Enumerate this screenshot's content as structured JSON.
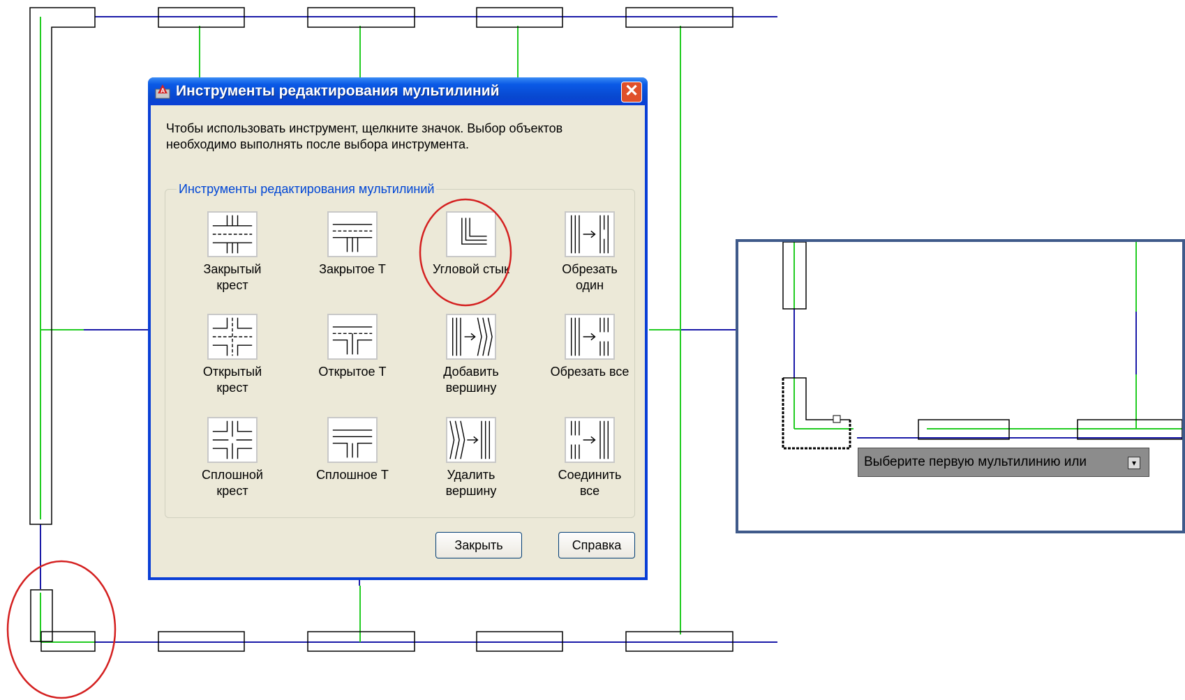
{
  "dialog": {
    "title": "Инструменты редактирования мультилиний",
    "close_glyph": "✕",
    "instruction": "Чтобы использовать инструмент, щелкните значок.  Выбор объектов\nнеобходимо выполнять после выбора инструмента.",
    "group_label": "Инструменты редактирования мультилиний",
    "tools": [
      {
        "label": "Закрытый\nкрест",
        "icon": "closed-cross-icon"
      },
      {
        "label": "Закрытое Т",
        "icon": "closed-tee-icon"
      },
      {
        "label": "Угловой стык",
        "icon": "corner-joint-icon"
      },
      {
        "label": "Обрезать\nодин",
        "icon": "cut-single-icon"
      },
      {
        "label": "Открытый\nкрест",
        "icon": "open-cross-icon"
      },
      {
        "label": "Открытое Т",
        "icon": "open-tee-icon"
      },
      {
        "label": "Добавить\nвершину",
        "icon": "add-vertex-icon"
      },
      {
        "label": "Обрезать все",
        "icon": "cut-all-icon"
      },
      {
        "label": "Сплошной\nкрест",
        "icon": "merged-cross-icon"
      },
      {
        "label": "Сплошное Т",
        "icon": "merged-tee-icon"
      },
      {
        "label": "Удалить\nвершину",
        "icon": "delete-vertex-icon"
      },
      {
        "label": "Соединить\nвсе",
        "icon": "weld-all-icon"
      }
    ],
    "close_button": "Закрыть",
    "help_button": "Справка"
  },
  "inset": {
    "tooltip_text": "Выберите первую мультилинию или",
    "tooltip_icon": "dropdown-arrow-icon"
  },
  "colors": {
    "centerline": "#1a1aa8",
    "wall_axis": "#22cc22",
    "highlight_circle": "#d42020",
    "titlebar": "#0a5ae6"
  }
}
